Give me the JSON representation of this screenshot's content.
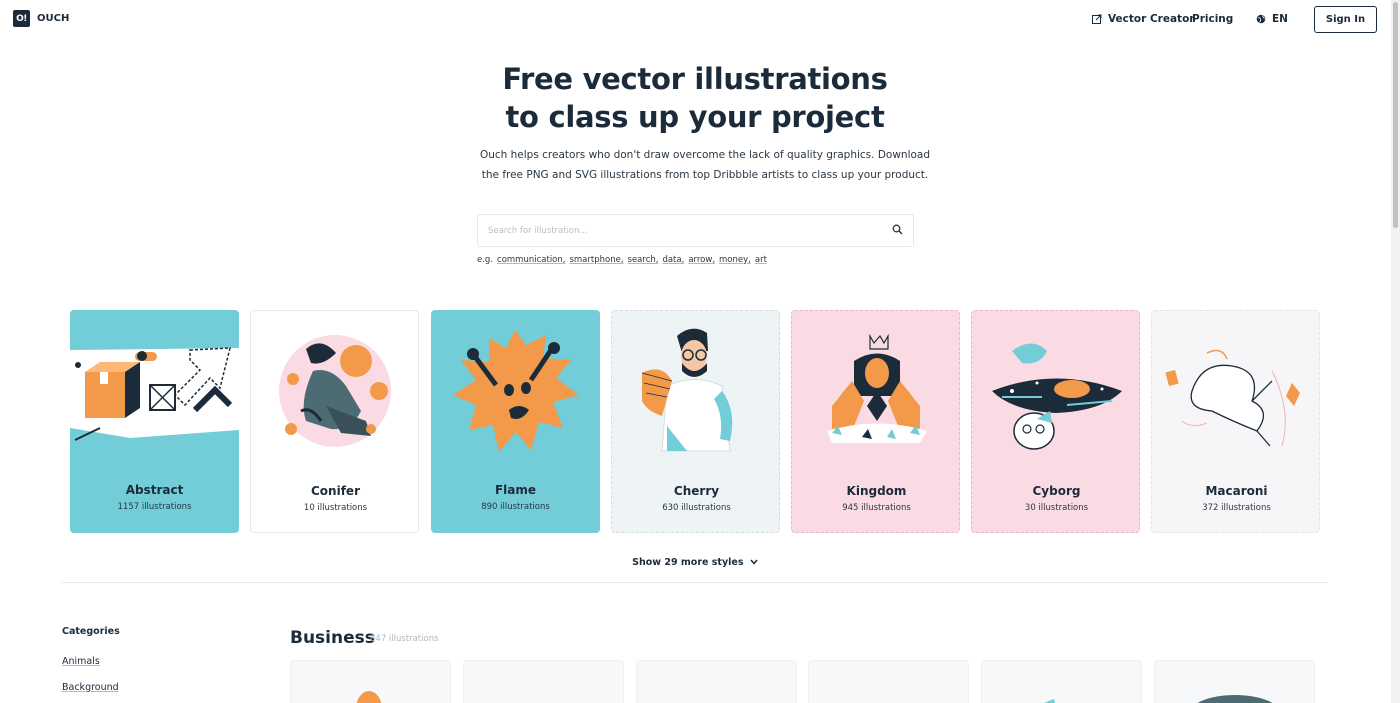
{
  "header": {
    "logo_mark": "O!",
    "logo_text": "OUCH",
    "vector_creator": "Vector Creator",
    "pricing": "Pricing",
    "language": "EN",
    "sign_in": "Sign In"
  },
  "hero": {
    "title_line1": "Free vector illustrations",
    "title_line2": "to class up your project",
    "subtitle_line1": "Ouch helps creators who don't draw overcome the lack of quality graphics. Download",
    "subtitle_line2": "the free PNG and SVG illustrations from top Dribbble artists to class up your product."
  },
  "search": {
    "placeholder": "Search for illustration...",
    "examples_prefix": "e.g.",
    "examples": [
      "communication,",
      "smartphone,",
      "search,",
      "data,",
      "arrow,",
      "money,",
      "art"
    ]
  },
  "styles": [
    {
      "name": "Abstract",
      "count": "1157 illustrations",
      "bg": "#72cdd8"
    },
    {
      "name": "Conifer",
      "count": "10 illustrations",
      "bg": "#ffffff"
    },
    {
      "name": "Flame",
      "count": "890 illustrations",
      "bg": "#72cdd8"
    },
    {
      "name": "Cherry",
      "count": "630 illustrations",
      "bg": "#eef3f6"
    },
    {
      "name": "Kingdom",
      "count": "945 illustrations",
      "bg": "#fbdbe3"
    },
    {
      "name": "Cyborg",
      "count": "30 illustrations",
      "bg": "#fbdbe3"
    },
    {
      "name": "Macaroni",
      "count": "372 illustrations",
      "bg": "#f6f6f8"
    }
  ],
  "show_more": "Show 29 more styles",
  "categories": {
    "heading": "Categories",
    "items": [
      "Animals",
      "Background"
    ]
  },
  "section": {
    "title": "Business",
    "count": "847 illustrations"
  },
  "colors": {
    "text_dark": "#1c2b3a",
    "accent_orange": "#f2994a",
    "teal": "#72cdd8",
    "pink": "#fbdbe3"
  }
}
